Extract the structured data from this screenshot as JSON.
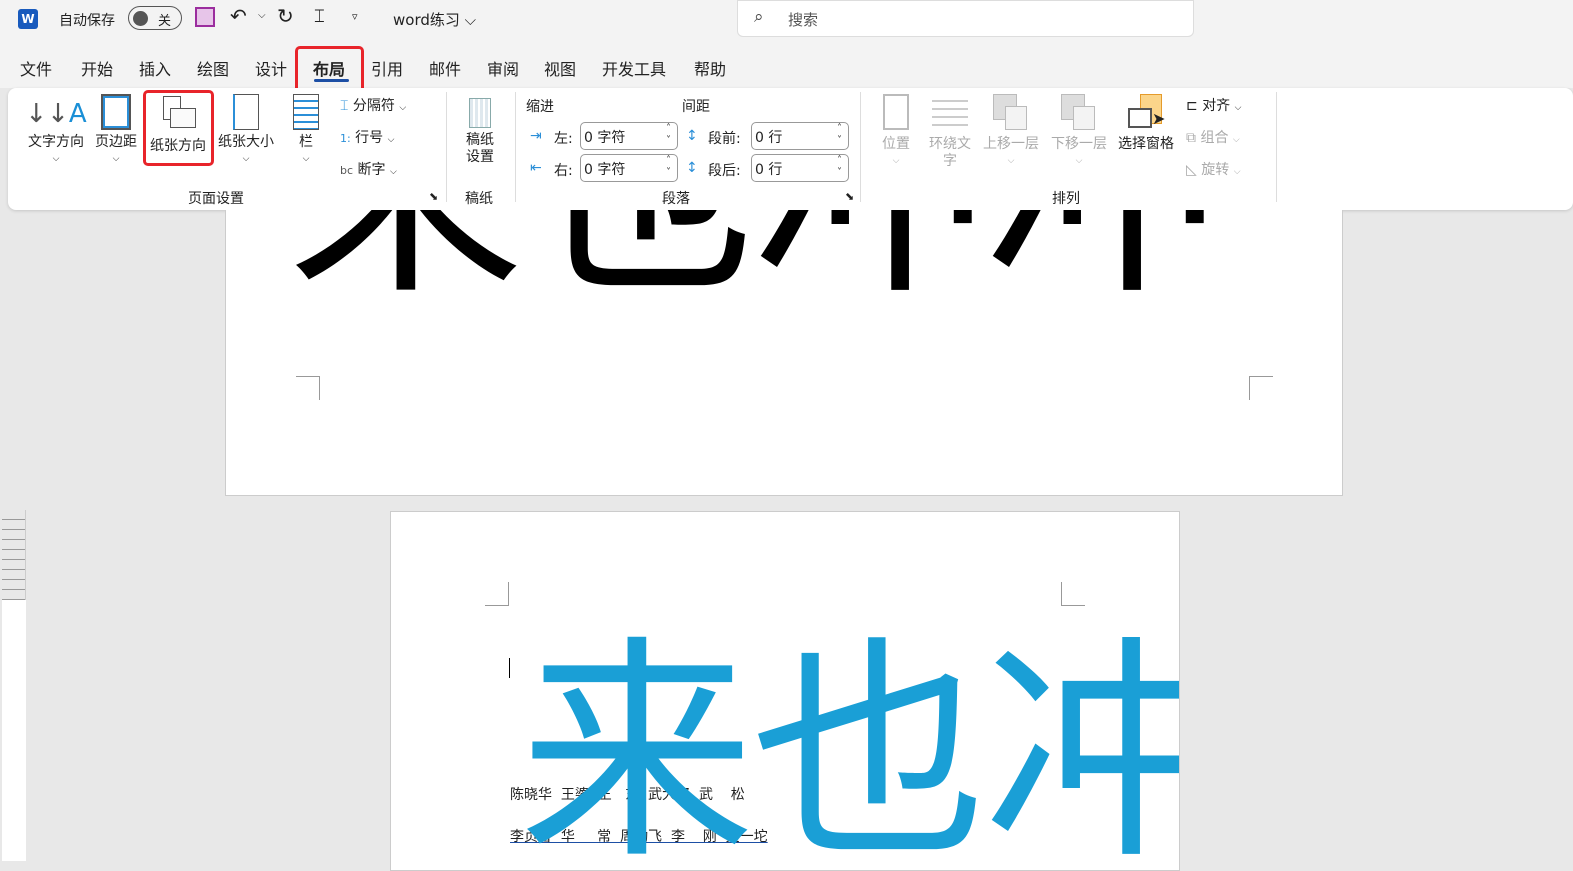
{
  "titlebar": {
    "autosave_label": "自动保存",
    "autosave_state": "关",
    "doc_title": "word练习 ⌵",
    "search_placeholder": "搜索"
  },
  "tabs": [
    "文件",
    "开始",
    "插入",
    "绘图",
    "设计",
    "布局",
    "引用",
    "邮件",
    "审阅",
    "视图",
    "开发工具",
    "帮助"
  ],
  "active_tab": "布局",
  "ribbon": {
    "page_setup": {
      "label": "页面设置",
      "text_direction": "文字方向",
      "margins": "页边距",
      "orientation": "纸张方向",
      "size": "纸张大小",
      "columns": "栏",
      "breaks": "分隔符",
      "line_numbers": "行号",
      "hyphenation": "断字"
    },
    "manuscript": {
      "label": "稿纸",
      "settings_1": "稿纸",
      "settings_2": "设置"
    },
    "paragraph": {
      "label": "段落",
      "indent": "缩进",
      "spacing": "间距",
      "left_label": "左:",
      "left_value": "0 字符",
      "right_label": "右:",
      "right_value": "0 字符",
      "before_label": "段前:",
      "before_value": "0 行",
      "after_label": "段后:",
      "after_value": "0 行"
    },
    "arrange": {
      "label": "排列",
      "position": "位置",
      "wrap_1": "环绕文",
      "wrap_2": "字",
      "bring_forward": "上移一层",
      "send_backward": "下移一层",
      "selection_pane": "选择窗格",
      "align": "对齐",
      "group": "组合",
      "rotate": "旋转"
    }
  },
  "document": {
    "page1_big_text": "来也冲冲",
    "page2_big_text": "来也冲",
    "line1": "陈晓华  王婆  王   东  武大郎  武    松",
    "line2": "李贞香  华     常  周勤飞  李    刚  史一坨",
    "accent": "#1a9fd6"
  }
}
